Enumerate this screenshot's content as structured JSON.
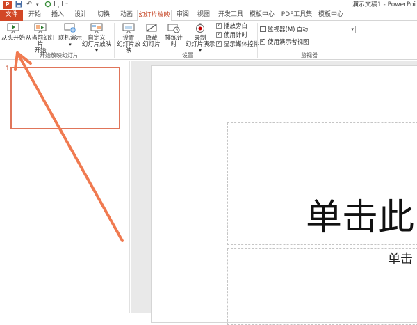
{
  "titlebar": {
    "app_icon": "P",
    "undo": "↶",
    "redo": "↷",
    "quick_more": "⁼",
    "title": "演示文稿1 - PowerPoi"
  },
  "tabs": [
    {
      "label": "文件"
    },
    {
      "label": "开始"
    },
    {
      "label": "插入"
    },
    {
      "label": "设计"
    },
    {
      "label": "切换"
    },
    {
      "label": "动画"
    },
    {
      "label": "幻灯片放映"
    },
    {
      "label": "审阅"
    },
    {
      "label": "视图"
    },
    {
      "label": "开发工具"
    },
    {
      "label": "模板中心"
    },
    {
      "label": "PDF工具集"
    },
    {
      "label": "模板中心"
    }
  ],
  "ribbon": {
    "start_group": {
      "from_beginning": "从头开始",
      "from_current_line1": "从当前幻灯片",
      "from_current_line2": "开始",
      "online_line1": "联机演示",
      "online_line2": "▾",
      "custom_line1": "自定义",
      "custom_line2": "幻灯片放映 ▾",
      "label": "开始放映幻灯片"
    },
    "setup_group": {
      "setup_line1": "设置",
      "setup_line2": "幻灯片放映",
      "hide_line1": "隐藏",
      "hide_line2": "幻灯片",
      "rehearse": "排练计时",
      "record_line1": "录制",
      "record_line2": "幻灯片演示 ▾",
      "play_narration": "播放旁白",
      "use_timings": "使用计时",
      "show_media": "显示媒体控件",
      "label": "设置"
    },
    "monitor_group": {
      "monitor_label": "监视器(M):",
      "monitor_value": "自动",
      "presenter_view": "使用演示者视图",
      "label": "监视器"
    }
  },
  "slides_pane": {
    "slide_number": "1"
  },
  "slide": {
    "title_placeholder": "单击此",
    "subtitle_placeholder": "单击"
  },
  "colors": {
    "accent": "#d24726",
    "annotation_arrow": "#f07a50"
  }
}
